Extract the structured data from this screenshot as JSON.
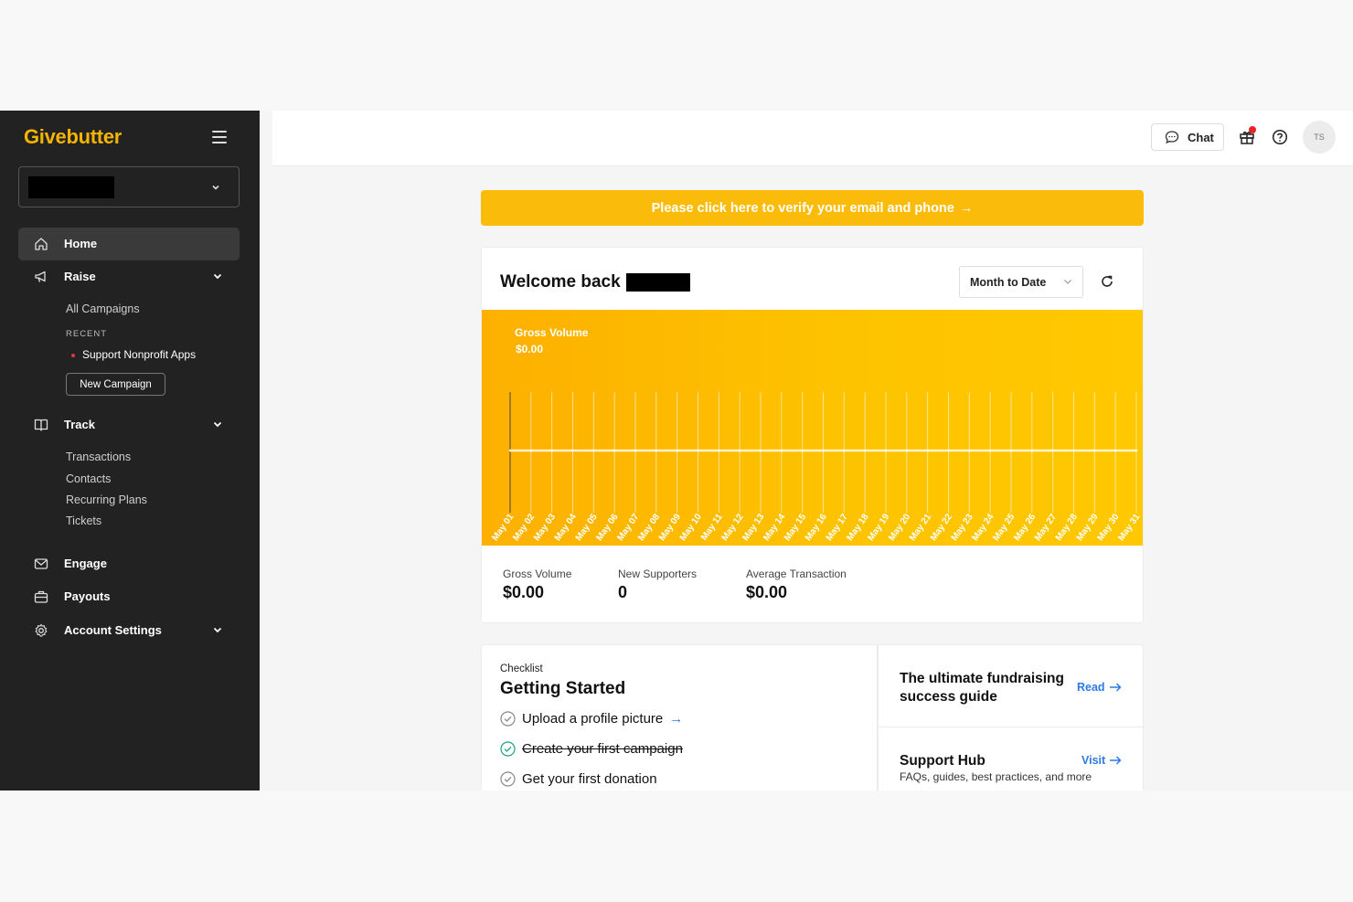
{
  "sidebar": {
    "logo": "Givebutter",
    "nav": {
      "home": "Home",
      "raise": "Raise",
      "track": "Track",
      "engage": "Engage",
      "payouts": "Payouts",
      "account_settings": "Account Settings"
    },
    "raise_links": {
      "all_campaigns": "All Campaigns",
      "recent_label": "RECENT",
      "recent_item": "Support Nonprofit Apps",
      "new_campaign": "New Campaign"
    },
    "track_links": [
      "Transactions",
      "Contacts",
      "Recurring Plans",
      "Tickets"
    ]
  },
  "topbar": {
    "chat_label": "Chat",
    "avatar_initials": "TS"
  },
  "banner": {
    "text": "Please click here to verify your email and phone",
    "arrow": "→"
  },
  "dashboard": {
    "welcome": "Welcome back",
    "period": "Month to Date",
    "stats": [
      {
        "label": "Gross Volume",
        "value": "$0.00"
      },
      {
        "label": "New Supporters",
        "value": "0"
      },
      {
        "label": "Average Transaction",
        "value": "$0.00"
      }
    ]
  },
  "chart_data": {
    "type": "line",
    "title": "Gross Volume",
    "total": "$0.00",
    "x": [
      "May 01",
      "May 02",
      "May 03",
      "May 04",
      "May 05",
      "May 06",
      "May 07",
      "May 08",
      "May 09",
      "May 10",
      "May 11",
      "May 12",
      "May 13",
      "May 14",
      "May 15",
      "May 16",
      "May 17",
      "May 18",
      "May 19",
      "May 20",
      "May 21",
      "May 22",
      "May 23",
      "May 24",
      "May 25",
      "May 26",
      "May 27",
      "May 28",
      "May 29",
      "May 30",
      "May 31"
    ],
    "series": [
      {
        "values": [
          0,
          0,
          0,
          0,
          0,
          0,
          0,
          0,
          0,
          0,
          0,
          0,
          0,
          0,
          0,
          0,
          0,
          0,
          0,
          0,
          0,
          0,
          0,
          0,
          0,
          0,
          0,
          0,
          0,
          0,
          0
        ]
      }
    ],
    "grid": true,
    "color": "#ffffff"
  },
  "checklist": {
    "caption": "Checklist",
    "title": "Getting Started",
    "items": [
      {
        "label": "Upload a profile picture",
        "arrow": "→"
      },
      {
        "label": "Create your first campaign"
      },
      {
        "label": "Get your first donation"
      }
    ]
  },
  "resources": {
    "guide_title_line1": "The ultimate fundraising",
    "guide_title_line2": "success guide",
    "guide_link": "Read",
    "hub_title": "Support Hub",
    "hub_link": "Visit",
    "hub_sub": "FAQs, guides, best practices, and more"
  },
  "colors": {
    "brand": "#f5b400",
    "banner": "#fbbb0a",
    "link": "#2c7be5",
    "sidebar": "#222222"
  }
}
